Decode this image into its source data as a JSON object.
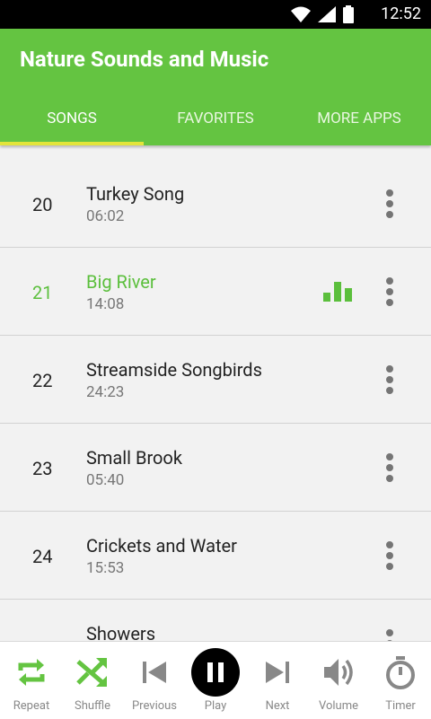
{
  "status_bar": {
    "time": "12:52"
  },
  "app_bar": {
    "title": "Nature Sounds and Music",
    "tabs": [
      {
        "label": "SONGS",
        "active": true
      },
      {
        "label": "FAVORITES",
        "active": false
      },
      {
        "label": "MORE APPS",
        "active": false
      }
    ]
  },
  "songs": [
    {
      "number": "20",
      "title": "Turkey Song",
      "duration": "06:02",
      "playing": false
    },
    {
      "number": "21",
      "title": "Big River",
      "duration": "14:08",
      "playing": true
    },
    {
      "number": "22",
      "title": "Streamside Songbirds",
      "duration": "24:23",
      "playing": false
    },
    {
      "number": "23",
      "title": "Small Brook",
      "duration": "05:40",
      "playing": false
    },
    {
      "number": "24",
      "title": "Crickets and Water",
      "duration": "15:53",
      "playing": false
    },
    {
      "number": "",
      "title": "Showers",
      "duration": "",
      "playing": false
    }
  ],
  "controls": {
    "repeat": "Repeat",
    "shuffle": "Shuffle",
    "previous": "Previous",
    "play": "Play",
    "next": "Next",
    "volume": "Volume",
    "timer": "Timer"
  },
  "colors": {
    "accent": "#64c441",
    "indicator": "#e3e43a",
    "active_text": "#5bbf3c"
  }
}
